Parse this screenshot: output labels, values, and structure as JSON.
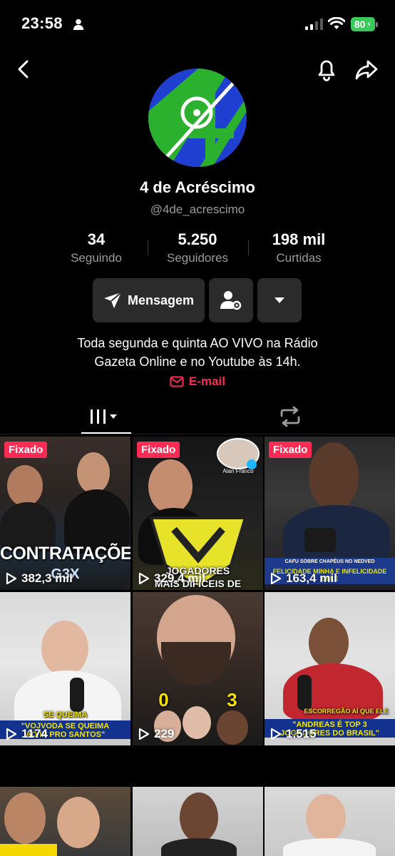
{
  "status_bar": {
    "time": "23:58",
    "battery": "80"
  },
  "profile": {
    "name": "4 de Acréscimo",
    "handle": "@4de_acrescimo",
    "bio_line1": "Toda segunda e quinta AO VIVO na Rádio",
    "bio_line2": "Gazeta Online e no Youtube às 14h.",
    "email_label": "E-mail"
  },
  "stats": [
    {
      "value": "34",
      "label": "Seguindo"
    },
    {
      "value": "5.250",
      "label": "Seguidores"
    },
    {
      "value": "198 mil",
      "label": "Curtidas"
    }
  ],
  "actions": {
    "message_label": "Mensagem"
  },
  "videos": [
    {
      "pinned": "Fixado",
      "views": "382,3 mil",
      "caption": "CONTRATAÇÕES",
      "sub": "G3X"
    },
    {
      "pinned": "Fixado",
      "views": "329,4 mil",
      "caption": "JOGADORES",
      "caption2": "MAIS DIFÍCEIS DE MARCAR",
      "tag": "Alan Franco"
    },
    {
      "pinned": "Fixado",
      "views": "163,4 mil",
      "caption": "FELICIDADE MINHA E INFELICIDADE DELE",
      "tag": "CAFU SOBRE CHAPÉUS NO NEDVED"
    },
    {
      "views": "1174",
      "caption": "\"VOJVODA SE QUEIMA",
      "caption2": "AO IR PRO SANTOS\"",
      "tag": "SE QUEIMA"
    },
    {
      "views": "229",
      "caption": "0",
      "caption2": "3"
    },
    {
      "views": "1.515",
      "caption": "\"ANDREAS É TOP 3",
      "caption2": "JOGADORES DO BRASIL\"",
      "tag": "ESCORREGÃO AÍ QUE ELE"
    },
    {},
    {},
    {}
  ],
  "colors": {
    "accent": "#fe2c55",
    "badge": "#fe2c55",
    "battery": "#37c95a",
    "button_bg": "#2b2b2b"
  }
}
